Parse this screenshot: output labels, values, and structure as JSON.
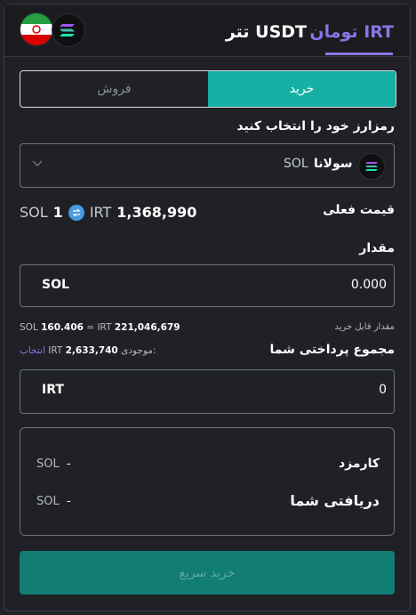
{
  "tabs": [
    {
      "label": "تومان IRT"
    },
    {
      "label": "تتر USDT"
    }
  ],
  "colors": {
    "accent": "#8b74e6",
    "primary": "#15b0a3",
    "button": "#117d75"
  },
  "trade": {
    "buy_label": "خرید",
    "sell_label": "فروش"
  },
  "crypto_select": {
    "label": "رمزارز خود را انتخاب کنید",
    "coin_name": "سولانا",
    "coin_symbol": "SOL",
    "icon": "solana-icon"
  },
  "current_price": {
    "label": "قیمت فعلی",
    "amount": "1",
    "amount_unit": "SOL",
    "price": "1,368,990",
    "price_unit": "IRT"
  },
  "quantity": {
    "label": "مقدار",
    "value": "0.000",
    "unit": "SOL"
  },
  "buyable": {
    "label": "مقدار قابل خرید",
    "sol_value": "160.406",
    "sol_unit": "SOL",
    "irt_value": "221,046,679",
    "irt_unit": "IRT",
    "approx": "≈"
  },
  "total": {
    "label": "مجموع پرداختی شما",
    "balance_label": "موجودی:",
    "balance_value": "2,633,740",
    "balance_unit": "IRT",
    "select_link": "انتخاب",
    "value": "0",
    "unit": "IRT"
  },
  "fees": {
    "fee_label": "کارمزد",
    "fee_value": "-",
    "fee_unit": "SOL",
    "receive_label": "دریافتی شما",
    "receive_value": "-",
    "receive_unit": "SOL"
  },
  "submit": {
    "label": "خرید سریع"
  }
}
